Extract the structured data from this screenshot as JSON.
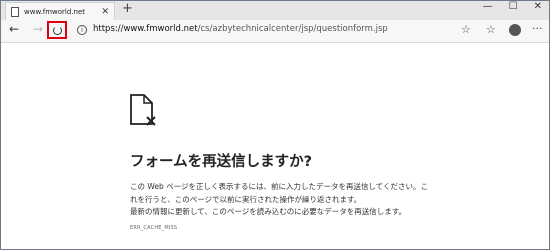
{
  "browser": {
    "tab_title": "www.fmworld.net",
    "tab_close": "✕",
    "new_tab": "+",
    "controls": [
      "—",
      "☐",
      "✕"
    ],
    "back": "←",
    "forward": "→",
    "info": "i",
    "url_host": "https://www.fmworld.net",
    "url_path": "/cs/azbytechnicalcenter/jsp/questionform.jsp",
    "favorite": "☆",
    "favorites_bar": "☆",
    "more": "···"
  },
  "page": {
    "title": "フォームを再送信しますか?",
    "paragraph1": "この Web ページを正しく表示するには、前に入力したデータを再送信してください。これを行うと、このページで以前に実行された操作が繰り返されます。",
    "paragraph2": "最新の情報に更新して、このページを読み込むのに必要なデータを再送信します。",
    "error_code": "ERR_CACHE_MISS"
  }
}
